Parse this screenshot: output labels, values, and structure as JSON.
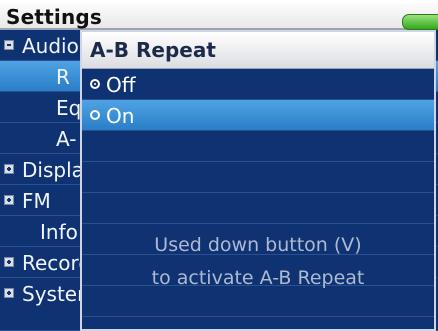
{
  "header": {
    "title": "Settings"
  },
  "list": {
    "rows": [
      {
        "label": "Audio",
        "bullet": "expanded"
      },
      {
        "label": "R"
      },
      {
        "label": "Eq"
      },
      {
        "label": "A-"
      },
      {
        "label": "Display",
        "bullet": "collapsed"
      },
      {
        "label": "FM",
        "bullet": "collapsed"
      },
      {
        "label": "Info"
      },
      {
        "label": "Record",
        "bullet": "collapsed"
      },
      {
        "label": "System",
        "bullet": "collapsed"
      }
    ]
  },
  "popup": {
    "title": "A-B Repeat",
    "options": [
      {
        "label": "Off",
        "checked": true
      },
      {
        "label": "On",
        "checked": false
      }
    ],
    "help_line1": "Used down button (V)",
    "help_line2": "to activate A-B Repeat"
  }
}
